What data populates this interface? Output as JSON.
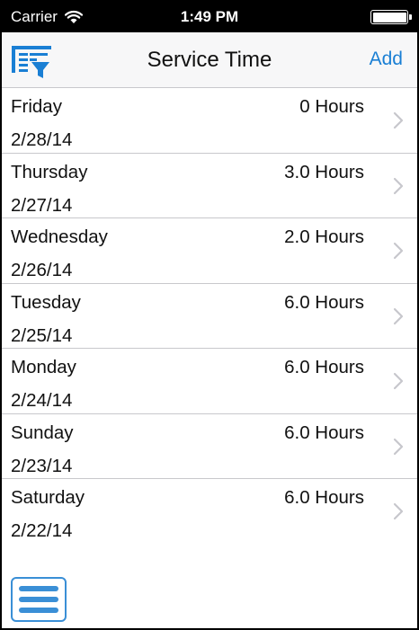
{
  "status_bar": {
    "carrier": "Carrier",
    "time": "1:49 PM"
  },
  "nav": {
    "title": "Service Time",
    "add_label": "Add",
    "filter_icon": "filter-list-icon"
  },
  "entries": [
    {
      "day": "Friday",
      "date": "2/28/14",
      "hours": "0 Hours"
    },
    {
      "day": "Thursday",
      "date": "2/27/14",
      "hours": "3.0 Hours"
    },
    {
      "day": "Wednesday",
      "date": "2/26/14",
      "hours": "2.0 Hours"
    },
    {
      "day": "Tuesday",
      "date": "2/25/14",
      "hours": "6.0 Hours"
    },
    {
      "day": "Monday",
      "date": "2/24/14",
      "hours": "6.0 Hours"
    },
    {
      "day": "Sunday",
      "date": "2/23/14",
      "hours": "6.0 Hours"
    },
    {
      "day": "Saturday",
      "date": "2/22/14",
      "hours": "6.0 Hours"
    }
  ],
  "bottom": {
    "menu_icon": "hamburger-menu-icon"
  },
  "colors": {
    "accent": "#1a7fd4",
    "menu_accent": "#3a8fd6",
    "separator": "#c8c8cc",
    "nav_background": "#f7f7f8"
  }
}
